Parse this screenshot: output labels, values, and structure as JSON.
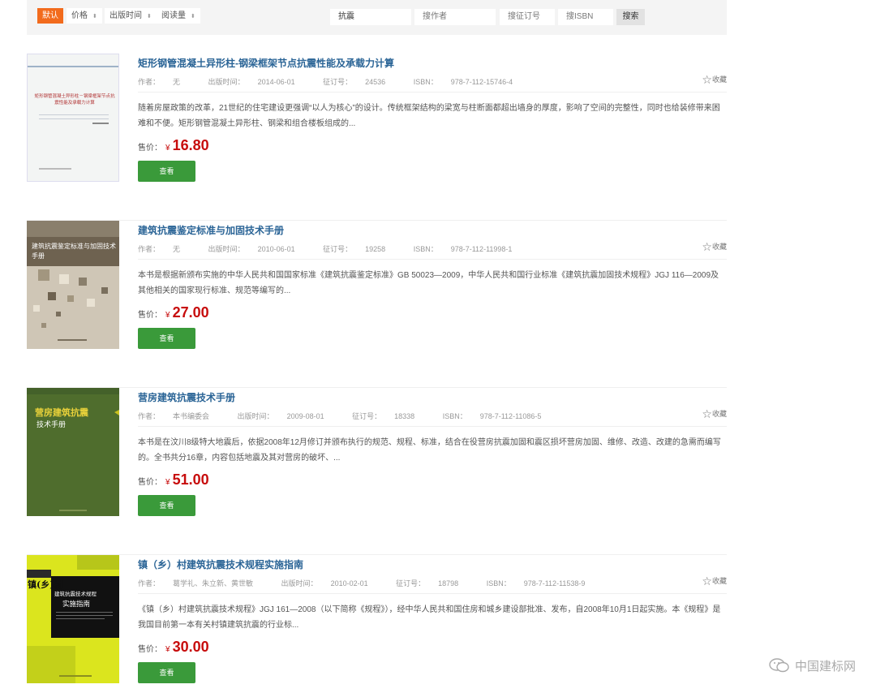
{
  "filters": {
    "sort_default": "默认",
    "sort_price": "价格",
    "sort_date": "出版时间",
    "sort_reads": "阅读量",
    "search_keyword": "抗震",
    "search_author_placeholder": "搜作者",
    "search_order_placeholder": "搜征订号",
    "search_isbn_placeholder": "搜ISBN",
    "search_button": "搜索"
  },
  "labels": {
    "author_prefix": "作者：",
    "date_prefix": "出版时间：",
    "order_prefix": "征订号：",
    "isbn_prefix": "ISBN：",
    "price_label": "售价：",
    "currency": "¥",
    "favorite": "收藏",
    "view_button": "查看"
  },
  "books": [
    {
      "title": "矩形钢管混凝土异形柱-钢梁框架节点抗震性能及承载力计算",
      "author": "无",
      "date": "2014-06-01",
      "order_no": "24536",
      "isbn": "978-7-112-15746-4",
      "description": "随着房屋政策的改革，21世纪的住宅建设更强调“以人为核心”的设计。传统框架结构的梁宽与柱断面都超出墙身的厚度，影响了空间的完整性，同时也给装修带来困难和不便。矩形钢管混凝土异形柱、钢梁和组合楼板组成的...",
      "price": "16.80",
      "cover_title": "矩形钢管混凝土异形柱－钢梁框架节点抗震性能及承载力计算"
    },
    {
      "title": "建筑抗震鉴定标准与加固技术手册",
      "author": "无",
      "date": "2010-06-01",
      "order_no": "19258",
      "isbn": "978-7-112-11998-1",
      "description": "本书是根据新颁布实施的中华人民共和国国家标准《建筑抗震鉴定标准》GB 50023—2009，中华人民共和国行业标准《建筑抗震加固技术规程》JGJ 116—2009及其他相关的国家现行标准、规范等编写的...",
      "price": "27.00",
      "cover_title": "建筑抗震鉴定标准与加固技术手册"
    },
    {
      "title": "营房建筑抗震技术手册",
      "author": "本书编委会",
      "date": "2009-08-01",
      "order_no": "18338",
      "isbn": "978-7-112-11086-5",
      "description": "本书是在汶川8级特大地震后，依据2008年12月修订并颁布执行的规范、规程、标准，结合在役营房抗震加固和震区损坏营房加固、维修、改造、改建的急需而编写的。全书共分16章，内容包括地震及其对营房的破坏、...",
      "price": "51.00",
      "cover_title_1": "营房建筑抗震",
      "cover_title_2": "技术手册"
    },
    {
      "title": "镇（乡）村建筑抗震技术规程实施指南",
      "author": "葛学礼、朱立新、黄世敏",
      "date": "2010-02-01",
      "order_no": "18798",
      "isbn": "978-7-112-11538-9",
      "description": "《镇（乡）村建筑抗震技术规程》JGJ 161—2008（以下简称《规程》），经中华人民共和国住房和城乡建设部批准、发布，自2008年10月1日起实施。本《规程》是我国目前第一本有关村镇建筑抗震的行业标...",
      "price": "30.00",
      "cover_title_1": "镇(乡)村",
      "cover_title_2": "建筑抗震技术规程",
      "cover_title_3": "实施指南"
    }
  ],
  "watermark": "中国建标网"
}
